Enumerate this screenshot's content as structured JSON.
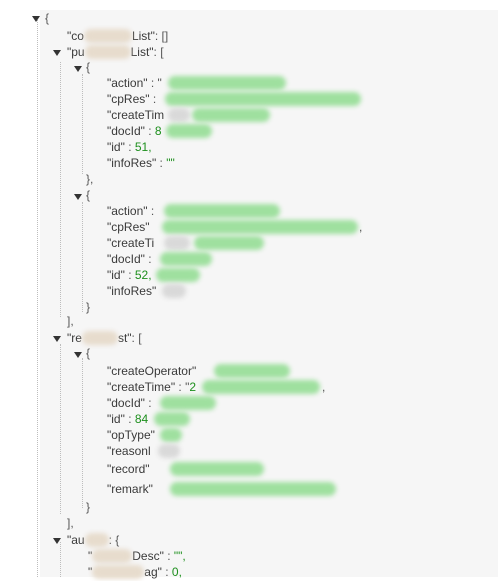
{
  "root": {
    "open": "{"
  },
  "commentList": {
    "key_prefix": "\"co",
    "key_suffix": "List\"",
    "rest": ": []"
  },
  "publishingList": {
    "key_prefix": "\"pu",
    "key_suffix": "List\"",
    "rest": ": [",
    "items": [
      {
        "open": "{",
        "action_key": "\"action\"",
        "action_sep": " : \"",
        "cpRes_key": "\"cpRes\"",
        "cpRes_sep": " :",
        "createTime_key": "\"createTim",
        "docId_key": "\"docId\"",
        "docId_sep": " : ",
        "docId_value": "8",
        "id_key": "\"id\"",
        "id_sep": " : ",
        "id_value": "51,",
        "infoRes_key": "\"infoRes\"",
        "infoRes_sep": " : ",
        "infoRes_value": "\"\"",
        "close": "},"
      },
      {
        "open": "{",
        "action_key": "\"action\"",
        "action_sep": " :",
        "cpRes_key": "\"cpRes\"",
        "cpRes_tail": ",",
        "createTime_key": "\"createTi",
        "docId_key": "\"docId\"",
        "docId_sep": " :",
        "id_key": "\"id\"",
        "id_sep": " : ",
        "id_value": "52,",
        "infoRes_key": "\"infoRes\"",
        "close": "}"
      }
    ],
    "close": "],"
  },
  "reviewList": {
    "key_prefix": "\"re",
    "key_suffix": "st\"",
    "rest": ": [",
    "item": {
      "open": "{",
      "createOperator_key": "\"createOperator\"",
      "createTime_key": "\"createTime\"",
      "createTime_sep": " : \"",
      "createTime_value": "2",
      "createTime_tail": ",",
      "docId_key": "\"docId\"",
      "docId_sep": " :",
      "id_key": "\"id\"",
      "id_sep": " : ",
      "id_value": "84",
      "opType_key": "\"opType\"",
      "reason_key": "\"reasonl",
      "record_key": "\"record\"",
      "remark_key": "\"remark\"",
      "close": "}"
    },
    "close": "],"
  },
  "author": {
    "key_prefix": "\"au",
    "rest": ": {",
    "line1_key_prefix": "\"",
    "line1_key_suffix": "Desc\"",
    "line1_sep": " : ",
    "line1_value": "\"\",",
    "line2_key_prefix": "\"",
    "line2_key_suffix": "ag\"",
    "line2_sep": " : ",
    "line2_value": "0,"
  }
}
